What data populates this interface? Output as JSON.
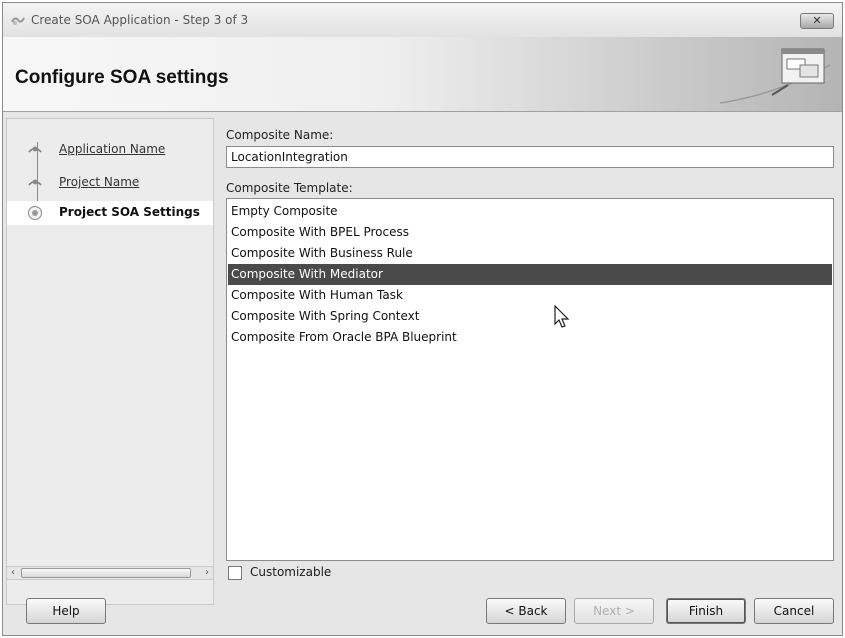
{
  "window": {
    "title": "Create SOA Application - Step 3 of 3",
    "close_label": "✕"
  },
  "header": {
    "heading": "Configure SOA settings"
  },
  "steps": [
    {
      "label": "Application Name",
      "state": "completed"
    },
    {
      "label": "Project Name",
      "state": "completed"
    },
    {
      "label": "Project SOA Settings",
      "state": "current"
    }
  ],
  "form": {
    "composite_name_label": "Composite Name:",
    "composite_name_value": "LocationIntegration",
    "composite_template_label": "Composite Template:",
    "templates": [
      "Empty Composite",
      "Composite With BPEL Process",
      "Composite With Business Rule",
      "Composite With Mediator",
      "Composite With Human Task",
      "Composite With Spring Context",
      "Composite From Oracle BPA Blueprint"
    ],
    "selected_template": "Composite With Mediator",
    "customizable_label": "Customizable",
    "customizable_checked": false
  },
  "buttons": {
    "help": "Help",
    "back": "< Back",
    "next": "Next >",
    "finish": "Finish",
    "cancel": "Cancel"
  },
  "colors": {
    "selection_bg": "#4a4a4a",
    "dialog_bg": "#e6e6e6"
  }
}
